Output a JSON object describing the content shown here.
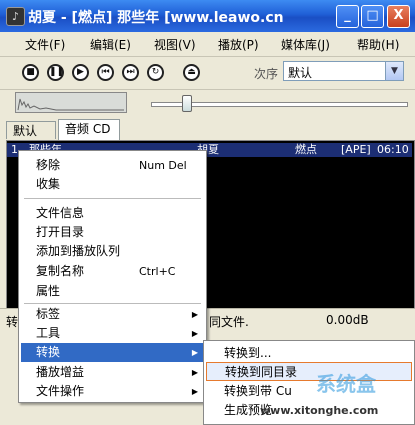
{
  "window": {
    "title": "胡夏 - [燃点] 那些年  [www.leawo.cn",
    "buttons": {
      "minimize": "_",
      "maximize": "□",
      "close": "X"
    }
  },
  "menubar": [
    "文件(F)",
    "编辑(E)",
    "视图(V)",
    "播放(P)",
    "媒体库(J)",
    "帮助(H)"
  ],
  "controls": {
    "order_label": "次序",
    "order_value": "默认"
  },
  "tabs": [
    "默认",
    "音频 CD"
  ],
  "playlist": {
    "row": {
      "index": "1",
      "title": "那些年",
      "artist": "胡夏",
      "album": "燃点",
      "format": "[APE]",
      "time": "06:10"
    }
  },
  "status": {
    "text": "转",
    "info": "同文件.",
    "gain": "0.00dB"
  },
  "context_menu": {
    "items": [
      {
        "label": "移除",
        "shortcut": "Num Del"
      },
      {
        "label": "收集",
        "shortcut": ""
      },
      {
        "label": "文件信息",
        "shortcut": ""
      },
      {
        "label": "打开目录",
        "shortcut": ""
      },
      {
        "label": "添加到播放队列",
        "shortcut": ""
      },
      {
        "label": "复制名称",
        "shortcut": "Ctrl+C"
      },
      {
        "label": "属性",
        "shortcut": ""
      },
      {
        "label": "标签",
        "shortcut": ""
      },
      {
        "label": "工具",
        "shortcut": ""
      },
      {
        "label": "转换",
        "shortcut": ""
      },
      {
        "label": "播放增益",
        "shortcut": ""
      },
      {
        "label": "文件操作",
        "shortcut": ""
      }
    ]
  },
  "submenu": {
    "items": [
      "转换到...",
      "转换到同目录",
      "转换到带 Cu",
      "生成预览"
    ]
  },
  "watermark": {
    "brand": "系统盒",
    "url": "www.xitonghe.com"
  }
}
